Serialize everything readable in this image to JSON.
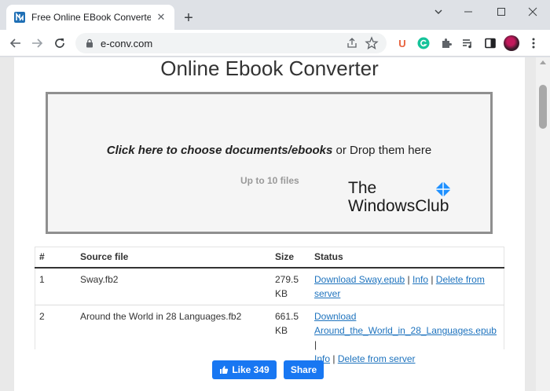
{
  "browser": {
    "tab_title": "Free Online EBook Converter (MO",
    "url": "e-conv.com",
    "extensions": {
      "u_label": "U"
    }
  },
  "page": {
    "title": "Online Ebook Converter",
    "dropzone": {
      "choose_text": "Click here to choose documents/ebooks",
      "drop_text": " or Drop them here",
      "limit": "Up to 10 files"
    },
    "watermark": {
      "line1": "The",
      "line2": "WindowsClub"
    },
    "table": {
      "headers": [
        "#",
        "Source file",
        "Size",
        "Status"
      ],
      "rows": [
        {
          "num": "1",
          "source": "Sway.fb2",
          "size": "279.5 KB",
          "download": "Download Sway.epub",
          "info": "Info",
          "delete": "Delete from server"
        },
        {
          "num": "2",
          "source": "Around the World in 28 Languages.fb2",
          "size": "661.5 KB",
          "download_line1": "Download",
          "download_line2": "Around_the_World_in_28_Languages.epub",
          "info": "Info",
          "delete": "Delete from server"
        }
      ]
    },
    "social": {
      "like": "Like 349",
      "share": "Share"
    }
  },
  "colors": {
    "accent": "#1e73be",
    "facebook": "#1877f2"
  }
}
